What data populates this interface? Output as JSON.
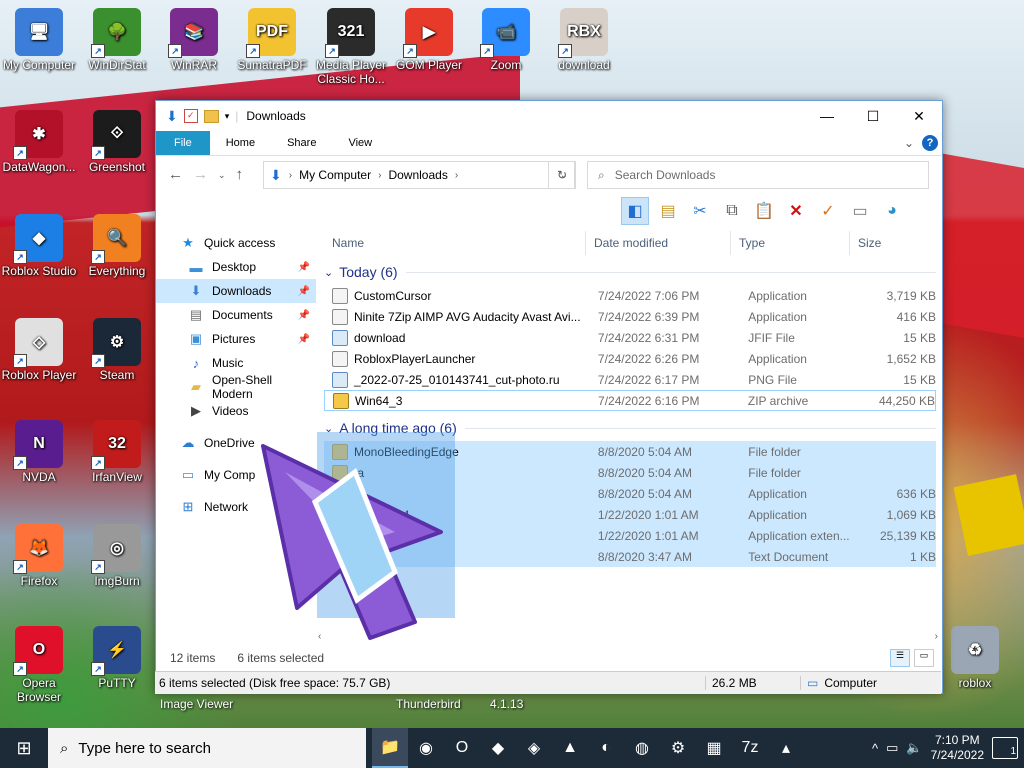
{
  "desktop_icons": [
    {
      "label": "My Computer",
      "color": "#3b7dd8",
      "glyph": "🖥"
    },
    {
      "label": "WinDirStat",
      "color": "#3a8f2e",
      "glyph": "🌳"
    },
    {
      "label": "WinRAR",
      "color": "#7b2d8f",
      "glyph": "📚"
    },
    {
      "label": "SumatraPDF",
      "color": "#f2c230",
      "glyph": "PDF"
    },
    {
      "label": "Media Player Classic Ho...",
      "color": "#2b2b2b",
      "glyph": "321"
    },
    {
      "label": "GOM Player",
      "color": "#e83a2a",
      "glyph": "▶"
    },
    {
      "label": "Zoom",
      "color": "#2d8cff",
      "glyph": "📹"
    },
    {
      "label": "download",
      "color": "#d8d0c8",
      "glyph": "RBX"
    },
    {
      "label": "DataWagon...",
      "color": "#b3102a",
      "glyph": "✱"
    },
    {
      "label": "Greenshot",
      "color": "#1c1c1c",
      "glyph": "⟐"
    },
    {
      "label": "Roblox Studio",
      "color": "#1c7fe6",
      "glyph": "◆"
    },
    {
      "label": "Everything",
      "color": "#f08020",
      "glyph": "🔍"
    },
    {
      "label": "Roblox Player",
      "color": "#e0e0e0",
      "glyph": "◇"
    },
    {
      "label": "Steam",
      "color": "#1b2838",
      "glyph": "⚙"
    },
    {
      "label": "NVDA",
      "color": "#5a1d8f",
      "glyph": "N"
    },
    {
      "label": "IrfanView",
      "color": "#c21b1b",
      "glyph": "32"
    },
    {
      "label": "Firefox",
      "color": "#ff7139",
      "glyph": "🦊"
    },
    {
      "label": "ImgBurn",
      "color": "#999999",
      "glyph": "◎"
    },
    {
      "label": "Opera Browser",
      "color": "#e0102a",
      "glyph": "O"
    },
    {
      "label": "PuTTY",
      "color": "#2a4c8f",
      "glyph": "⚡"
    },
    {
      "label": "roblox",
      "color": "#9aa6b3",
      "glyph": "♻"
    }
  ],
  "under_labels": {
    "image_viewer": "Image Viewer",
    "thunderbird": "Thunderbird",
    "version": "4.1.13"
  },
  "window": {
    "title": "Downloads",
    "minimize": "—",
    "maximize": "☐",
    "close": "✕",
    "ribbon_tabs": [
      "File",
      "Home",
      "Share",
      "View"
    ],
    "ribbon_expand": "⌄",
    "help": "?",
    "path": [
      "My Computer",
      "Downloads"
    ],
    "search_placeholder": "Search Downloads",
    "columns": {
      "name": "Name",
      "date": "Date modified",
      "type": "Type",
      "size": "Size"
    },
    "nav_pane": [
      {
        "label": "Quick access",
        "icon": "★",
        "color": "#1e88e5",
        "sub": false,
        "pinned": false,
        "selected": false
      },
      {
        "label": "Desktop",
        "icon": "▬",
        "color": "#3c8fd8",
        "sub": true,
        "pinned": true,
        "selected": false
      },
      {
        "label": "Downloads",
        "icon": "⬇",
        "color": "#3c7fd0",
        "sub": true,
        "pinned": true,
        "selected": true
      },
      {
        "label": "Documents",
        "icon": "▤",
        "color": "#6d6d6d",
        "sub": true,
        "pinned": true,
        "selected": false
      },
      {
        "label": "Pictures",
        "icon": "▣",
        "color": "#3c8fd8",
        "sub": true,
        "pinned": true,
        "selected": false
      },
      {
        "label": "Music",
        "icon": "♪",
        "color": "#2e6fcf",
        "sub": true,
        "pinned": false,
        "selected": false
      },
      {
        "label": "Open-Shell Modern",
        "icon": "▰",
        "color": "#e6b84a",
        "sub": true,
        "pinned": false,
        "selected": false
      },
      {
        "label": "Videos",
        "icon": "▶",
        "color": "#444",
        "sub": true,
        "pinned": false,
        "selected": false
      },
      {
        "label": "OneDrive",
        "icon": "☁",
        "color": "#2b7cd3",
        "sub": false,
        "pinned": false,
        "selected": false,
        "gap": true
      },
      {
        "label": "My Comp",
        "icon": "▭",
        "color": "#3c8fd8",
        "sub": false,
        "pinned": false,
        "selected": false,
        "gap": true
      },
      {
        "label": "Network",
        "icon": "⊞",
        "color": "#2b7cd3",
        "sub": false,
        "pinned": false,
        "selected": false,
        "gap": true
      }
    ],
    "groups": [
      {
        "title": "Today (6)",
        "files": [
          {
            "name": "CustomCursor",
            "date": "7/24/2022 7:06 PM",
            "type": "Application",
            "size": "3,719 KB",
            "kind": "app",
            "selected": false
          },
          {
            "name": "Ninite 7Zip AIMP AVG Audacity Avast Avi...",
            "date": "7/24/2022 6:39 PM",
            "type": "Application",
            "size": "416 KB",
            "kind": "app",
            "selected": false
          },
          {
            "name": "download",
            "date": "7/24/2022 6:31 PM",
            "type": "JFIF File",
            "size": "15 KB",
            "kind": "img",
            "selected": false
          },
          {
            "name": "RobloxPlayerLauncher",
            "date": "7/24/2022 6:26 PM",
            "type": "Application",
            "size": "1,652 KB",
            "kind": "app",
            "selected": false
          },
          {
            "name": "_2022-07-25_010143741_cut-photo.ru",
            "date": "7/24/2022 6:17 PM",
            "type": "PNG File",
            "size": "15 KB",
            "kind": "img",
            "selected": false
          },
          {
            "name": "Win64_3",
            "date": "7/24/2022 6:16 PM",
            "type": "ZIP archive",
            "size": "44,250 KB",
            "kind": "zip",
            "selected": false,
            "focus": true
          }
        ]
      },
      {
        "title": "A long time ago (6)",
        "files": [
          {
            "name": "MonoBleedingEdge",
            "date": "8/8/2020 5:04 AM",
            "type": "File folder",
            "size": "",
            "kind": "folder",
            "selected": true
          },
          {
            "name": "ta",
            "date": "8/8/2020 5:04 AM",
            "type": "File folder",
            "size": "",
            "kind": "folder",
            "selected": true
          },
          {
            "name": "",
            "date": "8/8/2020 5:04 AM",
            "type": "Application",
            "size": "636 KB",
            "kind": "app",
            "selected": true
          },
          {
            "name": "Handler64",
            "date": "1/22/2020 1:01 AM",
            "type": "Application",
            "size": "1,069 KB",
            "kind": "app",
            "selected": true
          },
          {
            "name": "",
            "date": "1/22/2020 1:01 AM",
            "type": "Application exten...",
            "size": "25,139 KB",
            "kind": "app",
            "selected": true
          },
          {
            "name": "",
            "date": "8/8/2020 3:47 AM",
            "type": "Text Document",
            "size": "1 KB",
            "kind": "txt",
            "selected": true
          }
        ]
      }
    ],
    "status_items": "12 items",
    "status_selected": "6 items selected",
    "details": {
      "left": "6 items selected (Disk free space: 75.7 GB)",
      "size": "26.2 MB",
      "location": "Computer"
    }
  },
  "taskbar": {
    "search_placeholder": "Type here to search",
    "apps": [
      "📁",
      "◉",
      "O",
      "◆",
      "◈",
      "▲",
      "◐",
      "◍",
      "⚙",
      "▦",
      "7z",
      "▴"
    ],
    "time": "7:10 PM",
    "date": "7/24/2022",
    "notifications": "1"
  },
  "colors": {
    "accent": "#1e96c8",
    "selection": "#cce8ff",
    "taskbar": "#1d2a38"
  }
}
